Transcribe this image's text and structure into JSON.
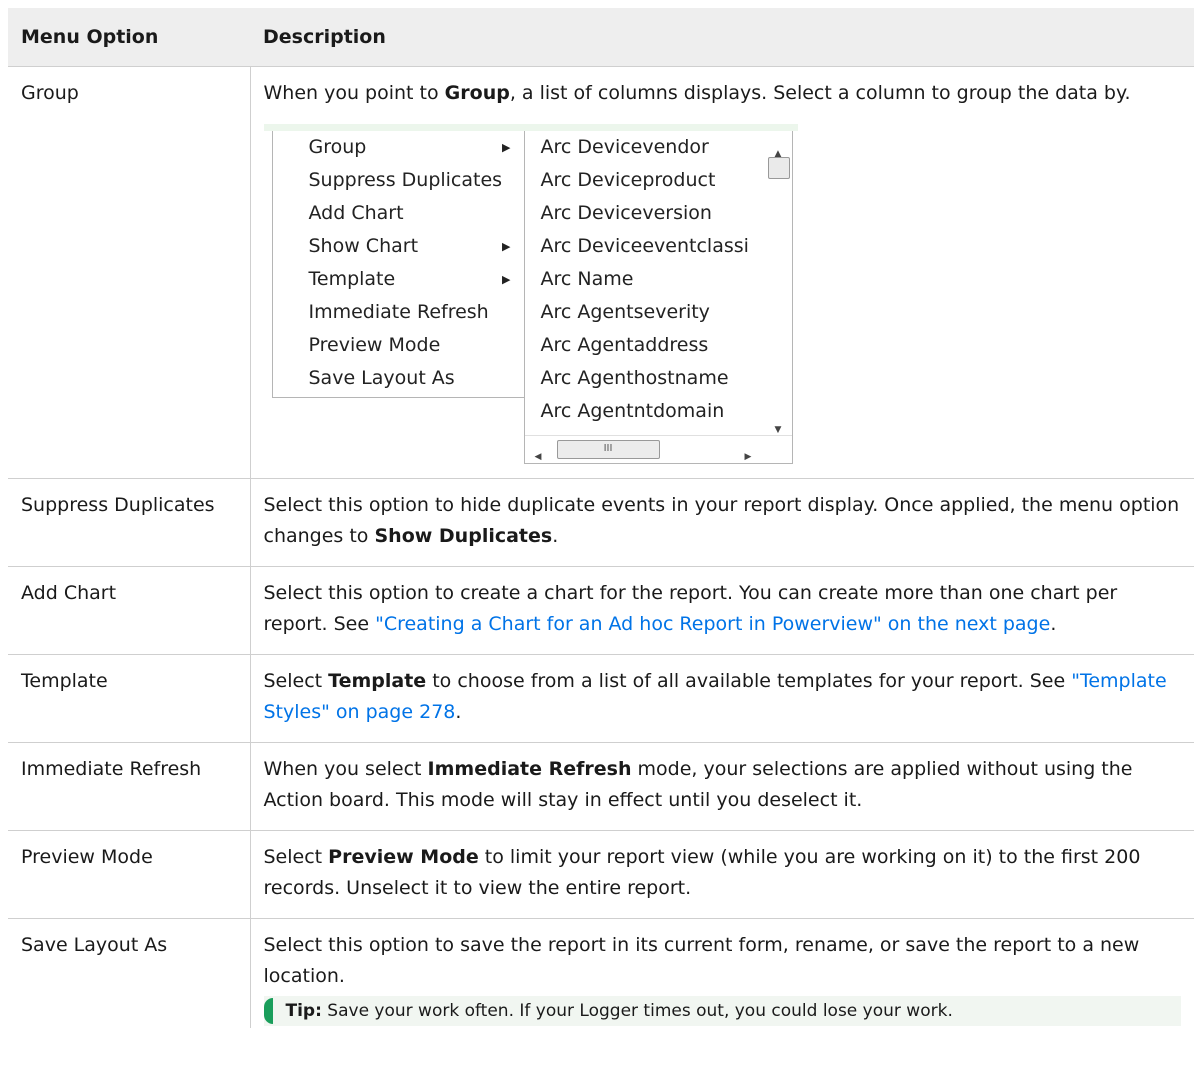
{
  "table": {
    "headers": [
      "Menu Option",
      "Description"
    ],
    "rows": {
      "group": {
        "option": "Group",
        "desc_pre": "When you point to ",
        "desc_bold": "Group",
        "desc_post": ", a list of columns displays. Select a column to group the data by."
      },
      "suppress": {
        "option": "Suppress Duplicates",
        "desc_pre": "Select this option to hide duplicate events in your report display. Once applied, the menu option changes to ",
        "desc_bold": "Show Duplicates",
        "desc_post": "."
      },
      "add_chart": {
        "option": "Add Chart",
        "desc_pre": "Select this option to create a chart for the report. You can create more than one chart per report. See ",
        "link": "\"Creating a Chart for an Ad hoc Report in Powerview\" on the next page",
        "desc_post": "."
      },
      "template": {
        "option": "Template",
        "desc_pre": "Select ",
        "desc_bold": "Template",
        "desc_mid": " to choose from a list of all available templates for your report. See ",
        "link": "\"Template Styles\" on page 278",
        "desc_post": "."
      },
      "refresh": {
        "option": "Immediate Refresh",
        "desc_pre": "When you select ",
        "desc_bold": "Immediate Refresh",
        "desc_post": " mode, your selections are applied without using the Action board. This mode will stay in effect until you deselect it."
      },
      "preview": {
        "option": "Preview Mode",
        "desc_pre": "Select ",
        "desc_bold": "Preview Mode",
        "desc_post": " to limit your report view (while you are working on it) to the first 200 records. Unselect it to view the entire report."
      },
      "save": {
        "option": "Save Layout As",
        "desc": "Select this option to save the report in its current form, rename, or save the report to a new location.",
        "tip_label": "Tip:",
        "tip_text": " Save your work often. If your Logger times out, you could lose your work."
      }
    }
  },
  "context_menu": {
    "items": [
      "Group",
      "Suppress Duplicates",
      "Add Chart",
      "Show Chart",
      "Template",
      "Immediate Refresh",
      "Preview Mode",
      "Save Layout As"
    ],
    "submenu_arrows": [
      "caret-right-icon",
      "caret-right-icon",
      "caret-right-icon"
    ],
    "columns": [
      "Arc Devicevendor",
      "Arc Deviceproduct",
      "Arc Deviceversion",
      "Arc Deviceeventclassi",
      "Arc Name",
      "Arc Agentseverity",
      "Arc Agentaddress",
      "Arc Agenthostname",
      "Arc Agentntdomain"
    ],
    "scroll_thumb_grip": "III"
  },
  "colors": {
    "link": "#0073e7",
    "header_bg": "#eeeeee",
    "tip_bar": "#1a9e5b"
  }
}
